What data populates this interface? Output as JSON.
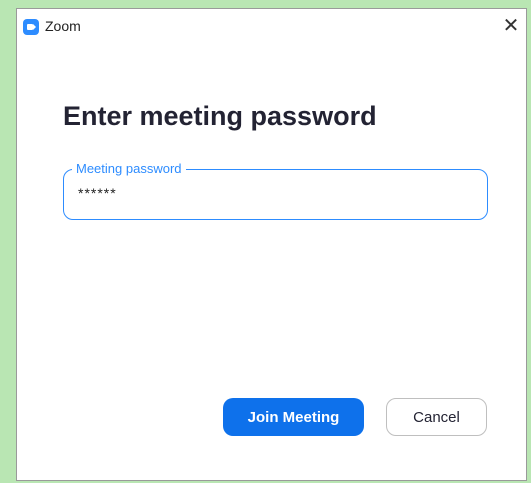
{
  "window": {
    "title": "Zoom",
    "icon": "zoom-app-icon",
    "close_icon": "close-icon",
    "close_glyph": "✕"
  },
  "dialog": {
    "heading": "Enter meeting password",
    "password_field": {
      "label": "Meeting password",
      "value": "******"
    },
    "join_button_label": "Join Meeting",
    "cancel_button_label": "Cancel"
  },
  "colors": {
    "accent": "#2d8cff",
    "primary_button": "#0e71eb",
    "background": "#b9e6b3"
  }
}
